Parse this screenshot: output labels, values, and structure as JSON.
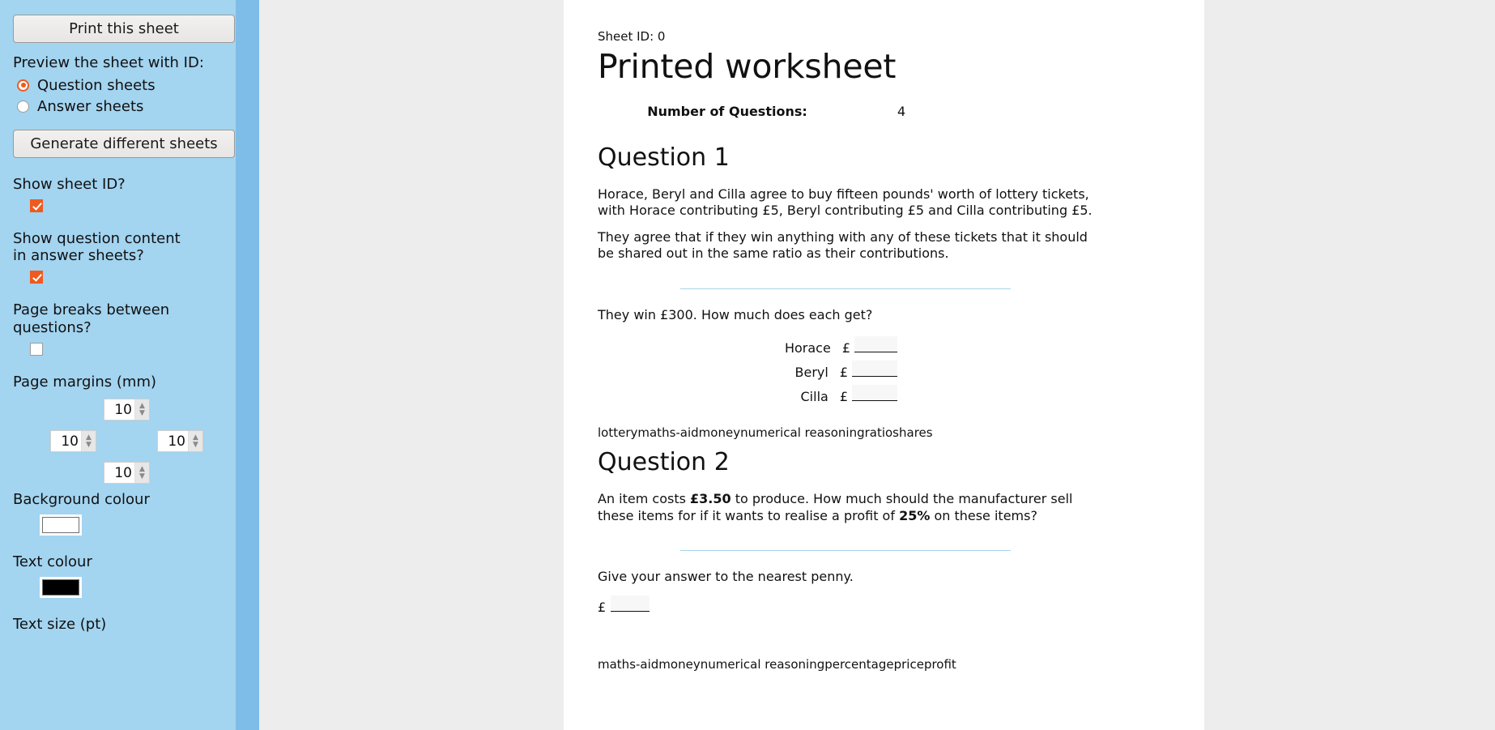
{
  "sidebar": {
    "print_button": "Print this sheet",
    "preview_label": "Preview the sheet with ID:",
    "radios": [
      {
        "label": "Question sheets",
        "checked": true
      },
      {
        "label": "Answer sheets",
        "checked": false
      }
    ],
    "generate_button": "Generate different sheets",
    "options": [
      {
        "label": "Show sheet ID?",
        "checked": true
      },
      {
        "label": "Show question content in answer sheets?",
        "checked": true
      },
      {
        "label": "Page breaks between questions?",
        "checked": false
      }
    ],
    "margins": {
      "label": "Page margins (mm)",
      "top": "10",
      "left": "10",
      "right": "10",
      "bottom": "10"
    },
    "background_colour": {
      "label": "Background colour",
      "value": "#ffffff"
    },
    "text_colour": {
      "label": "Text colour",
      "value": "#000000"
    },
    "text_size": {
      "label": "Text size (pt)"
    }
  },
  "worksheet": {
    "sheet_id": "Sheet ID: 0",
    "title": "Printed worksheet",
    "num_questions_label": "Number of Questions:",
    "num_questions_value": "4",
    "questions": [
      {
        "heading": "Question 1",
        "paragraphs": [
          "Horace, Beryl and Cilla agree to buy fifteen pounds' worth of lottery tickets, with Horace contributing £5, Beryl contributing £5 and Cilla contributing £5.",
          "They agree that if they win anything with any of these tickets that it should be shared out in the same ratio as their contributions."
        ],
        "prompt": "They win £300. How much does each get?",
        "answer_rows": [
          {
            "name": "Horace",
            "currency": "£"
          },
          {
            "name": "Beryl",
            "currency": "£"
          },
          {
            "name": "Cilla",
            "currency": "£"
          }
        ],
        "tags": "lotterymaths-aidmoneynumerical reasoningratioshares"
      },
      {
        "heading": "Question 2",
        "body_pre": "An item costs ",
        "body_bold1": "£3.50",
        "body_mid": " to produce. How much should the manufacturer sell these items for if it wants to realise a profit of ",
        "body_bold2": "25%",
        "body_post": " on these items?",
        "prompt": "Give your answer to the nearest penny.",
        "currency": "£",
        "tags": "maths-aidmoneynumerical reasoningpercentagepriceprofit"
      }
    ]
  },
  "colors": {
    "sidebar_bg": "#a3d4f0",
    "sidebar_scrollbar": "#7dbde8",
    "accent": "#ef5a1f",
    "page_bg": "#ffffff",
    "app_bg": "#ededed",
    "divider": "#a7d4ea"
  }
}
